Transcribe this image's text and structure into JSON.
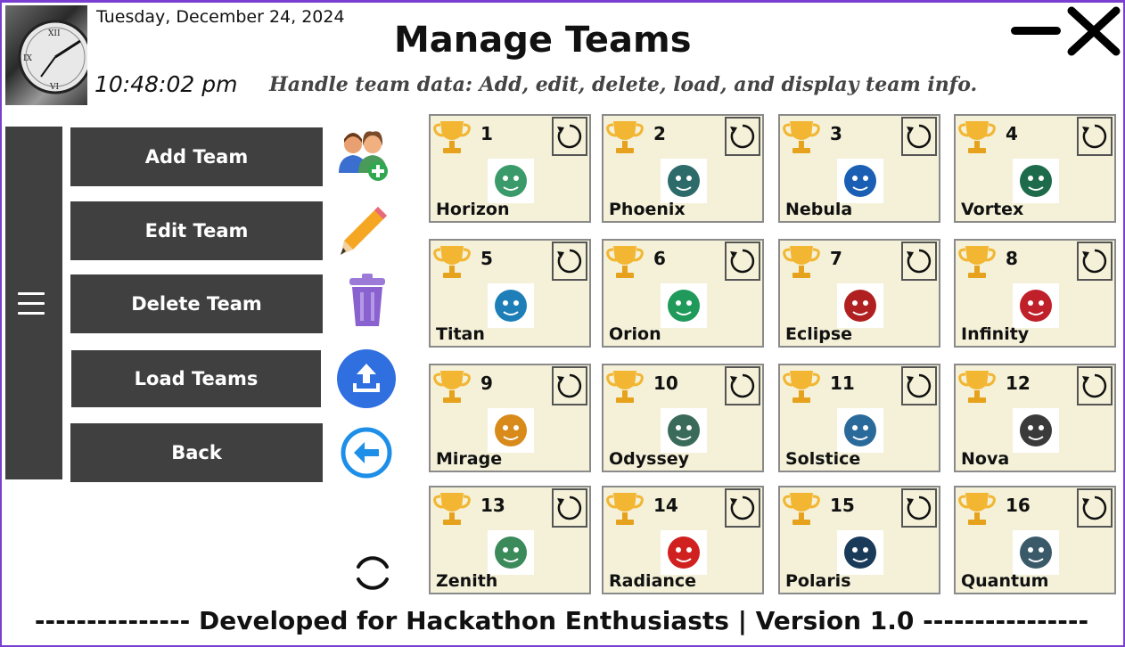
{
  "header": {
    "date": "Tuesday, December 24, 2024",
    "time": "10:48:02 pm",
    "title": "Manage Teams",
    "subtitle": "Handle team data: Add, edit, delete, load, and display team info."
  },
  "nav": {
    "add_label": "Add Team",
    "edit_label": "Edit Team",
    "delete_label": "Delete Team",
    "load_label": "Load Teams",
    "back_label": "Back"
  },
  "teams": [
    {
      "number": "1",
      "name": "Horizon",
      "logo_color": "#3a9a6a"
    },
    {
      "number": "2",
      "name": "Phoenix",
      "logo_color": "#2d6b6b"
    },
    {
      "number": "3",
      "name": "Nebula",
      "logo_color": "#1a5fb4"
    },
    {
      "number": "4",
      "name": "Vortex",
      "logo_color": "#1d6b4a"
    },
    {
      "number": "5",
      "name": "Titan",
      "logo_color": "#1e7fb8"
    },
    {
      "number": "6",
      "name": "Orion",
      "logo_color": "#1f9a5a"
    },
    {
      "number": "7",
      "name": "Eclipse",
      "logo_color": "#b02020"
    },
    {
      "number": "8",
      "name": "Infinity",
      "logo_color": "#c0202a"
    },
    {
      "number": "9",
      "name": "Mirage",
      "logo_color": "#d88a1a"
    },
    {
      "number": "10",
      "name": "Odyssey",
      "logo_color": "#3a6a5a"
    },
    {
      "number": "11",
      "name": "Solstice",
      "logo_color": "#2a6a9a"
    },
    {
      "number": "12",
      "name": "Nova",
      "logo_color": "#3a3a3a"
    },
    {
      "number": "13",
      "name": "Zenith",
      "logo_color": "#3a8a5a"
    },
    {
      "number": "14",
      "name": "Radiance",
      "logo_color": "#d02020"
    },
    {
      "number": "15",
      "name": "Polaris",
      "logo_color": "#1a3a5a"
    },
    {
      "number": "16",
      "name": "Quantum",
      "logo_color": "#3a5a6a"
    }
  ],
  "footer": {
    "text": "--------------- Developed for Hackathon Enthusiasts | Version 1.0 ----------------"
  },
  "colors": {
    "accent_border": "#7a3fd0",
    "nav_bg": "#404040",
    "card_bg": "#f4f1d8",
    "trophy": "#f2b632"
  }
}
